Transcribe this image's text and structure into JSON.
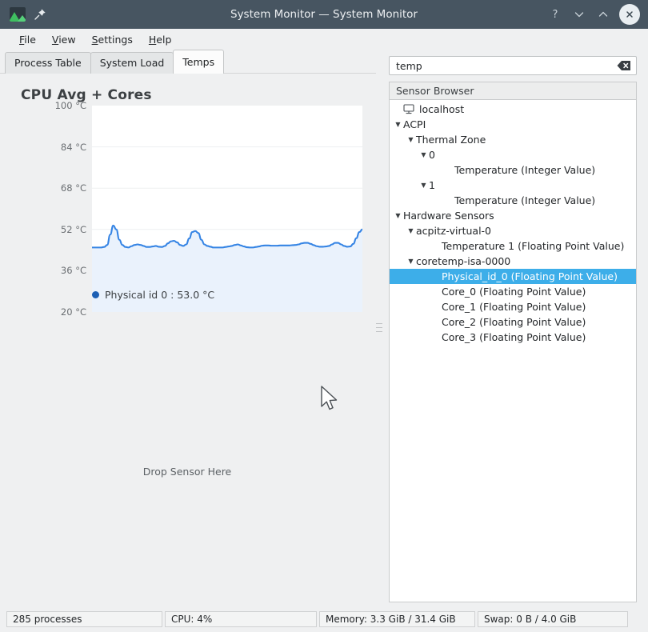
{
  "window": {
    "title": "System Monitor — System Monitor",
    "app_icon": "chart-app-icon",
    "pin_icon": "pin-icon",
    "help_label": "?",
    "minimize_label": "⌄",
    "maximize_label": "⌃",
    "close_label": "✕"
  },
  "menubar": {
    "items": [
      {
        "label": "File",
        "accel": "F"
      },
      {
        "label": "View",
        "accel": "V"
      },
      {
        "label": "Settings",
        "accel": "S"
      },
      {
        "label": "Help",
        "accel": "H"
      }
    ]
  },
  "tabs": [
    {
      "label": "Process Table",
      "active": false
    },
    {
      "label": "System Load",
      "active": false
    },
    {
      "label": "Temps",
      "active": true
    }
  ],
  "chart_panel": {
    "drop_hint": "Drop Sensor Here"
  },
  "chart_data": {
    "type": "line",
    "title": "CPU Avg + Cores",
    "xlabel": "",
    "ylabel": "",
    "ylim": [
      20,
      100
    ],
    "yticks": [
      100,
      84,
      68,
      52,
      36,
      20
    ],
    "ytick_labels": [
      "100 °C",
      "84 °C",
      "68 °C",
      "52 °C",
      "36 °C",
      "20 °C"
    ],
    "grid": true,
    "legend_position": "bottom-left",
    "area_fill": true,
    "line_color": "#3584e4",
    "fill_color": "#eaf2fc",
    "legend_dot_color": "#1c5fb4",
    "series": [
      {
        "name": "Physical id 0",
        "legend_label": "Physical id 0 : 53.0 °C",
        "current_value": 53.0,
        "unit": "°C",
        "values": [
          45.0,
          45.0,
          45.0,
          45.0,
          45.2,
          46.0,
          50.0,
          53.5,
          52.0,
          48.0,
          46.0,
          45.2,
          45.0,
          45.5,
          46.0,
          46.2,
          46.0,
          45.6,
          45.2,
          45.2,
          45.4,
          45.6,
          45.3,
          45.2,
          45.6,
          46.6,
          47.4,
          47.6,
          47.0,
          46.0,
          45.6,
          46.2,
          48.5,
          51.0,
          51.4,
          50.6,
          48.0,
          46.2,
          45.6,
          45.3,
          45.0,
          45.0,
          45.0,
          45.0,
          45.2,
          45.4,
          45.6,
          46.0,
          46.2,
          45.8,
          45.4,
          45.1,
          45.0,
          45.0,
          45.2,
          45.4,
          45.7,
          45.8,
          45.8,
          45.7,
          45.7,
          45.7,
          45.8,
          45.8,
          45.8,
          45.8,
          45.9,
          46.0,
          46.2,
          46.6,
          46.8,
          46.8,
          46.4,
          45.9,
          45.5,
          45.3,
          45.3,
          45.4,
          45.6,
          46.2,
          46.8,
          46.8,
          46.2,
          45.6,
          45.3,
          45.4,
          46.4,
          48.6,
          51.0,
          52.0
        ]
      }
    ]
  },
  "search": {
    "value": "temp",
    "placeholder": "",
    "clear_icon": "clear-icon"
  },
  "sensor_browser": {
    "header": "Sensor Browser",
    "nodes": [
      {
        "label": "localhost",
        "depth": 0,
        "expander": "none",
        "icon": "monitor-icon",
        "selected": false
      },
      {
        "label": "ACPI",
        "depth": 0,
        "expander": "expanded",
        "icon": "",
        "selected": false
      },
      {
        "label": "Thermal Zone",
        "depth": 1,
        "expander": "expanded",
        "icon": "",
        "selected": false
      },
      {
        "label": "0",
        "depth": 2,
        "expander": "expanded",
        "icon": "",
        "selected": false
      },
      {
        "label": "Temperature (Integer Value)",
        "depth": 4,
        "expander": "none",
        "icon": "",
        "selected": false
      },
      {
        "label": "1",
        "depth": 2,
        "expander": "expanded",
        "icon": "",
        "selected": false
      },
      {
        "label": "Temperature (Integer Value)",
        "depth": 4,
        "expander": "none",
        "icon": "",
        "selected": false
      },
      {
        "label": "Hardware Sensors",
        "depth": 0,
        "expander": "expanded",
        "icon": "",
        "selected": false
      },
      {
        "label": "acpitz-virtual-0",
        "depth": 1,
        "expander": "expanded",
        "icon": "",
        "selected": false
      },
      {
        "label": "Temperature 1 (Floating Point Value)",
        "depth": 3,
        "expander": "none",
        "icon": "",
        "selected": false
      },
      {
        "label": "coretemp-isa-0000",
        "depth": 1,
        "expander": "expanded",
        "icon": "",
        "selected": false
      },
      {
        "label": "Physical_id_0 (Floating Point Value)",
        "depth": 3,
        "expander": "none",
        "icon": "",
        "selected": true
      },
      {
        "label": "Core_0 (Floating Point Value)",
        "depth": 3,
        "expander": "none",
        "icon": "",
        "selected": false
      },
      {
        "label": "Core_1 (Floating Point Value)",
        "depth": 3,
        "expander": "none",
        "icon": "",
        "selected": false
      },
      {
        "label": "Core_2 (Floating Point Value)",
        "depth": 3,
        "expander": "none",
        "icon": "",
        "selected": false
      },
      {
        "label": "Core_3 (Floating Point Value)",
        "depth": 3,
        "expander": "none",
        "icon": "",
        "selected": false
      }
    ]
  },
  "statusbar": {
    "processes": "285 processes",
    "cpu": "CPU: 4%",
    "memory": "Memory: 3.3 GiB / 31.4 GiB",
    "swap": "Swap: 0 B / 4.0 GiB"
  }
}
